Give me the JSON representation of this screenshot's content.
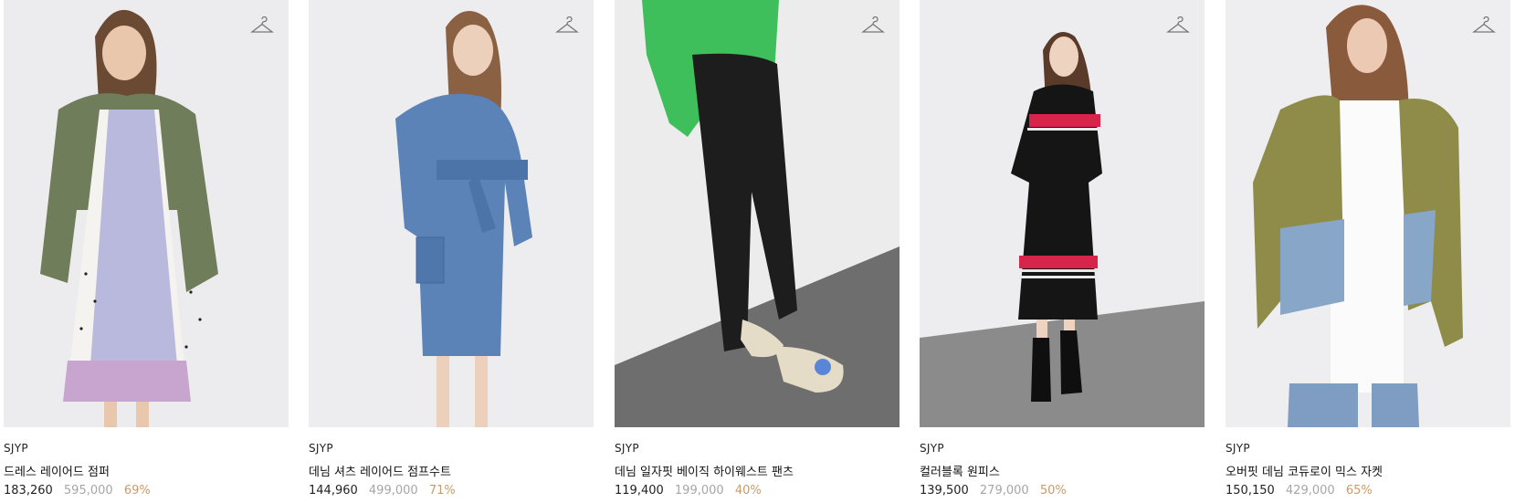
{
  "products": [
    {
      "brand": "SJYP",
      "name": "드레스 레이어드 점퍼",
      "price": "183,260",
      "original_price": "595,000",
      "discount": "69%",
      "image_icon": "hanger-icon"
    },
    {
      "brand": "SJYP",
      "name": "데님 셔츠 레이어드 점프수트",
      "price": "144,960",
      "original_price": "499,000",
      "discount": "71%",
      "image_icon": "hanger-icon"
    },
    {
      "brand": "SJYP",
      "name": "데님 일자핏 베이직 하이웨스트 팬츠",
      "price": "119,400",
      "original_price": "199,000",
      "discount": "40%",
      "image_icon": "hanger-icon"
    },
    {
      "brand": "SJYP",
      "name": "컬러블록 원피스",
      "price": "139,500",
      "original_price": "279,000",
      "discount": "50%",
      "image_icon": "hanger-icon"
    },
    {
      "brand": "SJYP",
      "name": "오버핏 데님 코듀로이 믹스 자켓",
      "price": "150,150",
      "original_price": "429,000",
      "discount": "65%",
      "image_icon": "hanger-icon"
    }
  ],
  "colors": {
    "price": "#222222",
    "original_price": "#a6a6a6",
    "discount": "#c99a6b"
  }
}
